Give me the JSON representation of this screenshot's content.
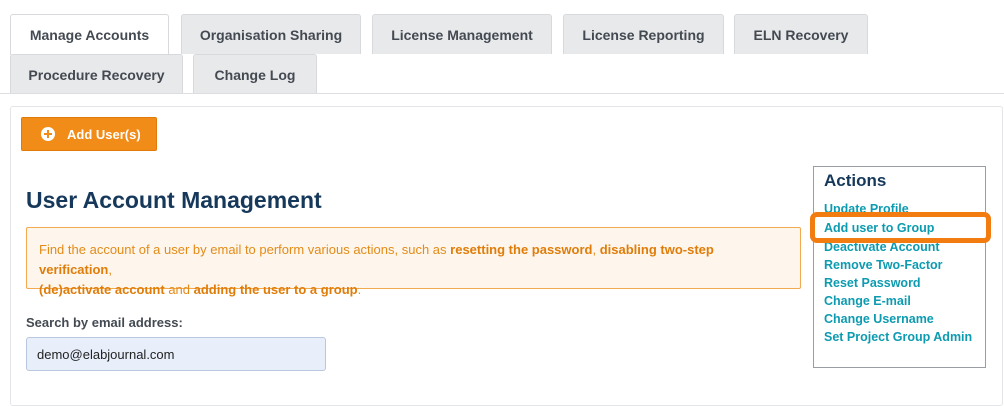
{
  "tabs": [
    {
      "label": "Manage Accounts",
      "active": true
    },
    {
      "label": "Organisation Sharing"
    },
    {
      "label": "License Management"
    },
    {
      "label": "License Reporting"
    },
    {
      "label": "ELN Recovery"
    },
    {
      "label": "Procedure Recovery"
    },
    {
      "label": "Change Log"
    }
  ],
  "toolbar": {
    "add_users_label": "Add User(s)"
  },
  "main": {
    "title": "User Account Management",
    "info": {
      "prefix": "Find the account of a user by email to perform various actions, such as ",
      "b1": "resetting the password",
      "sep1": ", ",
      "b2": "disabling two-step verification",
      "sep2": ",",
      "b3": "(de)activate account",
      "sep3": " and ",
      "b4": "adding the user to a group",
      "suffix": "."
    },
    "search": {
      "label": "Search by email address:",
      "value": "demo@elabjournal.com"
    }
  },
  "actions": {
    "title": "Actions",
    "items": [
      "Update Profile",
      "Add user to Group",
      "Deactivate Account",
      "Remove Two-Factor",
      "Reset Password",
      "Change E-mail",
      "Change Username",
      "Set Project Group Admin"
    ]
  },
  "colors": {
    "accent": "#f28c18",
    "link": "#0d9bb0",
    "title": "#16385a"
  }
}
